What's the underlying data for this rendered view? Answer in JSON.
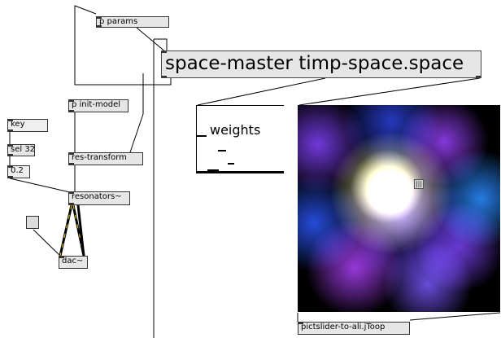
{
  "patcher": {
    "objects": {
      "p_params": "p params",
      "space_master": "space-master timp-space.space",
      "p_init_model": "p init-model",
      "key": "key",
      "sel": "sel 32",
      "msg_02": "0.2",
      "res_transform": "res-transform",
      "resonators": "resonators~",
      "dac": "dac~",
      "pictslider_out": "pictslider-to-ali.jToop"
    },
    "weights_label": "weights",
    "thumb_icon": "grip-icon",
    "colors": {
      "object_bg": "#e6e6e6",
      "patch_cord": "#000000",
      "signal_cord_stripe": "#f2d21b",
      "background": "#ffffff"
    }
  }
}
